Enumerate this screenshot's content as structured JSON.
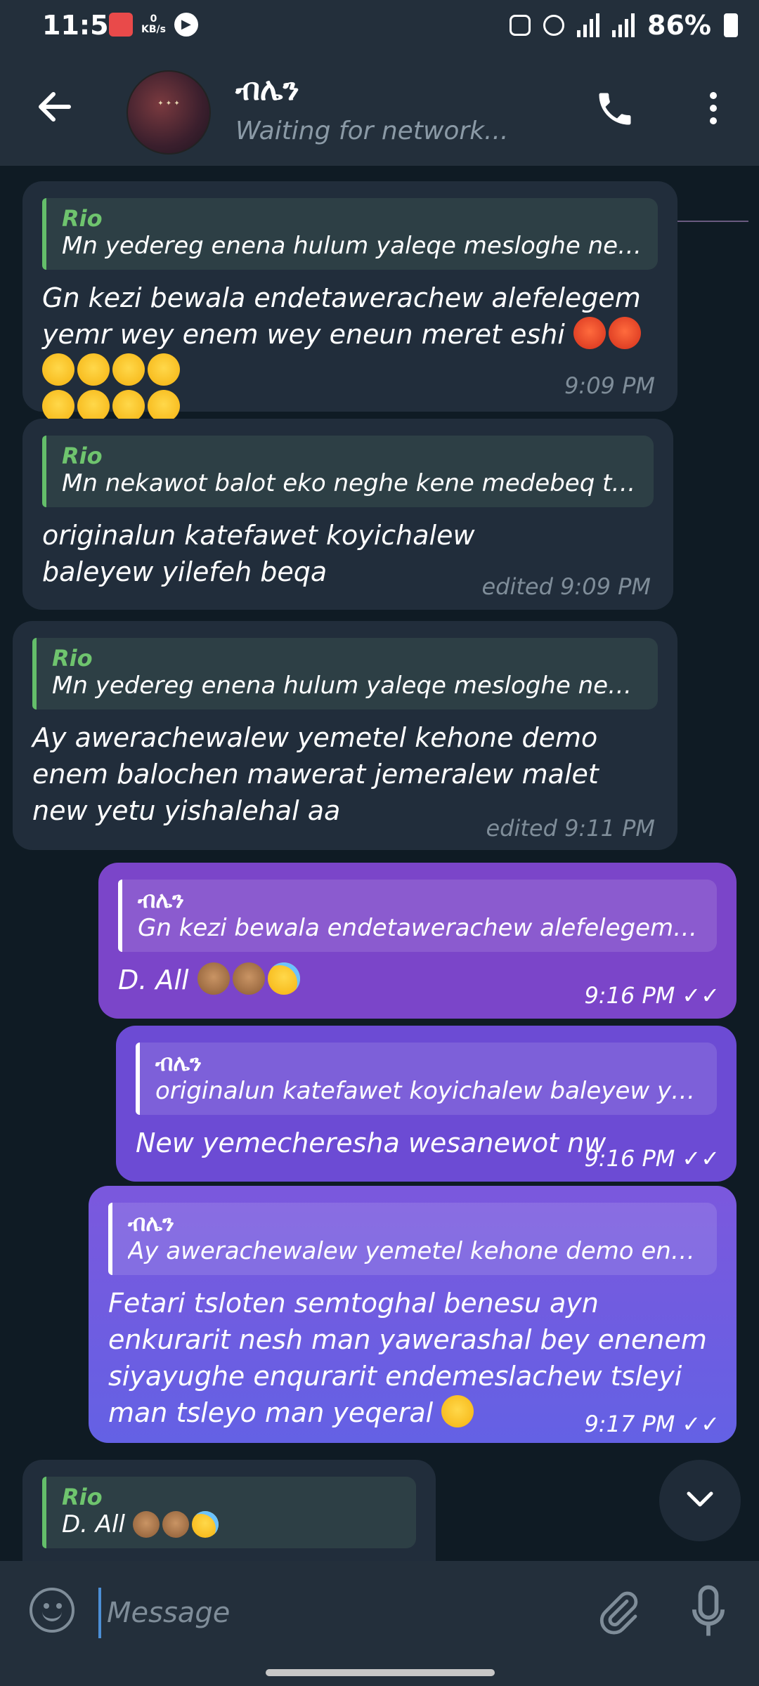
{
  "status_bar": {
    "time": "11:58",
    "net_speed": "0",
    "net_unit": "KB/s",
    "battery": "86%"
  },
  "header": {
    "title": "ብሌን",
    "subtitle": "Waiting for network..."
  },
  "messages": [
    {
      "direction": "in",
      "reply_name": "Rio",
      "reply_text": "Mn yedereg enena hulum yaleqe mesloghe neber gn te...",
      "text": "Gn kezi bewala endetawerachew alefelegem yemr wey enem wey eneun meret eshi",
      "emojis": [
        "angry",
        "angry",
        "tongue",
        "tongue",
        "tongue",
        "tongue",
        "tongue",
        "tongue",
        "tongue",
        "tongue"
      ],
      "time": "9:09 PM"
    },
    {
      "direction": "in",
      "reply_name": "Rio",
      "reply_text": "Mn nekawot balot eko neghe kene medebeq tejemere b...",
      "text": "originalun katefawet koyichalew baleyew yilefeh beqa",
      "time": "edited 9:09 PM"
    },
    {
      "direction": "in",
      "reply_name": "Rio",
      "reply_text": "Mn yedereg enena hulum yaleqe mesloghe neber gn te...",
      "text": "Ay awerachewalew yemetel kehone demo enem balochen mawerat jemeralew malet new yetu yishalehal aa",
      "time": "edited 9:11 PM"
    },
    {
      "direction": "out",
      "reply_name": "ብሌን",
      "reply_text": "Gn kezi bewala endetawerachew alefelegem yemr we...",
      "text": "D. All",
      "time": "9:16 PM"
    },
    {
      "direction": "out",
      "reply_name": "ብሌን",
      "reply_text": "originalun katefawet koyichalew baleyew yilefeh beqa",
      "text": "New yemecheresha wesanewot nw",
      "time": "9:16 PM"
    },
    {
      "direction": "out",
      "reply_name": "ብሌን",
      "reply_text": "Ay awerachewalew yemetel kehone demo enem baloc...",
      "text": "Fetari tsloten semtoghal benesu ayn enkurarit nesh man yawerashal bey enenem siyayughe enqurarit endemeslachew tsleyi man tsleyo man yeqeral",
      "time": "9:17 PM"
    },
    {
      "direction": "in",
      "reply_name": "Rio",
      "reply_text": "D. All"
    }
  ],
  "composer": {
    "placeholder": "Message"
  },
  "icons": [
    "back-arrow-icon",
    "phone-icon",
    "more-vert-icon",
    "emoji-icon",
    "attach-icon",
    "mic-icon",
    "chevron-down-icon",
    "double-check-icon"
  ]
}
